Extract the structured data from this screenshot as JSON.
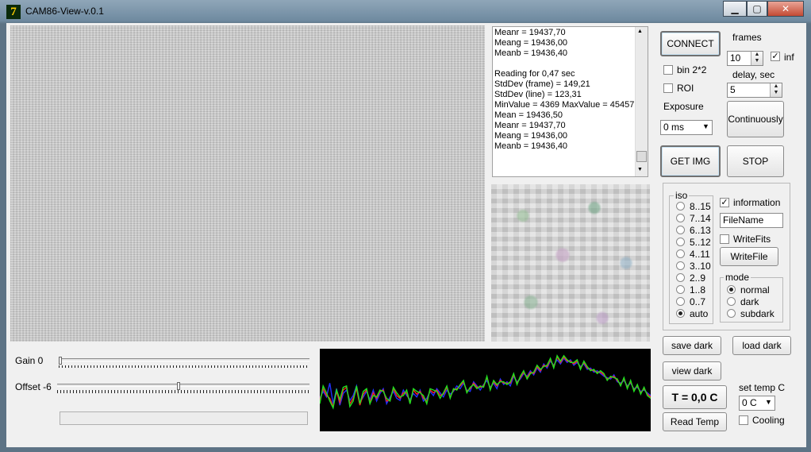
{
  "window": {
    "title": "CAM86-View-v.0.1",
    "app_icon_glyph": "7",
    "caption_buttons": {
      "minimize": "▁",
      "maximize": "▢",
      "close": "✕"
    }
  },
  "log": {
    "lines": [
      "Meanr = 19437,70",
      "Meang = 19436,00",
      "Meanb = 19436,40",
      "",
      "Reading for 0,47 sec",
      "StdDev (frame) = 149,21",
      "StdDev (line) = 123,31",
      "MinValue = 4369 MaxValue = 45457",
      "Mean = 19436,50",
      "Meanr = 19437,70",
      "Meang = 19436,00",
      "Meanb = 19436,40"
    ]
  },
  "controls": {
    "connect": "CONNECT",
    "frames_label": "frames",
    "frames_value": "10",
    "inf_label": "inf",
    "inf_checked": true,
    "bin_label": "bin 2*2",
    "roi_label": "ROI",
    "delay_label": "delay, sec",
    "delay_value": "5",
    "exposure_label": "Exposure",
    "exposure_value": "0 ms",
    "continuously": "Continuously",
    "get_img": "GET IMG",
    "stop": "STOP"
  },
  "iso": {
    "legend": "iso",
    "options": [
      "8..15",
      "7..14",
      "6..13",
      "5..12",
      "4..11",
      "3..10",
      "2..9",
      "1..8",
      "0..7",
      "auto"
    ],
    "selected": "auto"
  },
  "output": {
    "information_label": "information",
    "information_checked": true,
    "filename_value": "FileName",
    "writefits_label": "WriteFits",
    "writefile": "WriteFile"
  },
  "mode": {
    "legend": "mode",
    "options": [
      "normal",
      "dark",
      "subdark"
    ],
    "selected": "normal"
  },
  "dark": {
    "save": "save dark",
    "load": "load dark",
    "view": "view dark"
  },
  "temp": {
    "display": "T = 0,0 C",
    "read": "Read Temp",
    "set_label": "set temp C",
    "set_value": "0 C",
    "cooling_label": "Cooling"
  },
  "sliders": {
    "gain_label": "Gain 0",
    "gain_value": 0,
    "offset_label": "Offset -6",
    "offset_fraction": 0.48
  },
  "histogram": {
    "colors": {
      "red": "#ff2020",
      "green": "#20e020",
      "blue": "#2030ff",
      "background": "#000000"
    },
    "series": [
      {
        "color": "blue",
        "values": [
          48,
          58,
          50,
          70,
          40,
          62,
          38,
          55,
          60,
          45,
          52,
          66,
          42,
          50,
          58,
          46,
          60,
          44,
          55,
          62,
          40,
          50,
          58,
          48,
          45,
          60,
          52,
          46,
          55,
          50,
          60,
          44,
          48,
          58,
          52,
          62,
          56,
          50,
          60,
          54,
          58,
          66,
          62,
          70,
          60,
          58,
          72,
          66,
          60,
          68,
          74,
          64,
          70,
          62,
          76,
          68,
          72,
          66,
          80,
          72,
          76,
          84,
          80,
          88,
          82,
          92,
          86,
          98,
          92,
          102,
          96,
          104,
          98,
          106,
          100,
          104,
          96,
          100,
          94,
          98,
          90,
          92,
          86,
          88,
          84,
          80,
          78,
          76,
          82,
          72,
          70,
          74,
          66,
          70,
          62,
          64,
          58,
          60,
          56,
          52
        ]
      },
      {
        "color": "red",
        "values": [
          45,
          62,
          52,
          48,
          36,
          58,
          42,
          60,
          64,
          40,
          48,
          62,
          38,
          54,
          60,
          42,
          56,
          48,
          58,
          60,
          44,
          46,
          62,
          52,
          48,
          56,
          56,
          42,
          60,
          54,
          58,
          48,
          44,
          60,
          56,
          60,
          52,
          54,
          64,
          50,
          60,
          62,
          66,
          72,
          58,
          62,
          70,
          64,
          64,
          66,
          78,
          62,
          72,
          66,
          74,
          70,
          70,
          70,
          82,
          70,
          78,
          86,
          78,
          86,
          84,
          94,
          88,
          96,
          94,
          104,
          94,
          108,
          100,
          108,
          102,
          102,
          98,
          102,
          92,
          100,
          92,
          90,
          88,
          86,
          86,
          82,
          76,
          78,
          80,
          74,
          68,
          76,
          64,
          72,
          60,
          66,
          56,
          62,
          54,
          50
        ]
      },
      {
        "color": "green",
        "values": [
          40,
          66,
          56,
          44,
          34,
          60,
          46,
          64,
          66,
          36,
          44,
          66,
          40,
          58,
          62,
          40,
          52,
          50,
          60,
          58,
          48,
          44,
          64,
          56,
          50,
          52,
          60,
          40,
          62,
          58,
          56,
          52,
          40,
          62,
          60,
          58,
          48,
          56,
          66,
          48,
          62,
          60,
          68,
          74,
          56,
          64,
          68,
          62,
          66,
          64,
          80,
          60,
          74,
          68,
          72,
          72,
          68,
          72,
          84,
          68,
          80,
          88,
          76,
          84,
          86,
          96,
          90,
          94,
          96,
          106,
          92,
          110,
          102,
          110,
          104,
          100,
          100,
          104,
          90,
          102,
          94,
          88,
          90,
          84,
          88,
          84,
          74,
          80,
          78,
          76,
          66,
          78,
          62,
          74,
          58,
          68,
          54,
          64,
          52,
          48
        ]
      }
    ]
  }
}
